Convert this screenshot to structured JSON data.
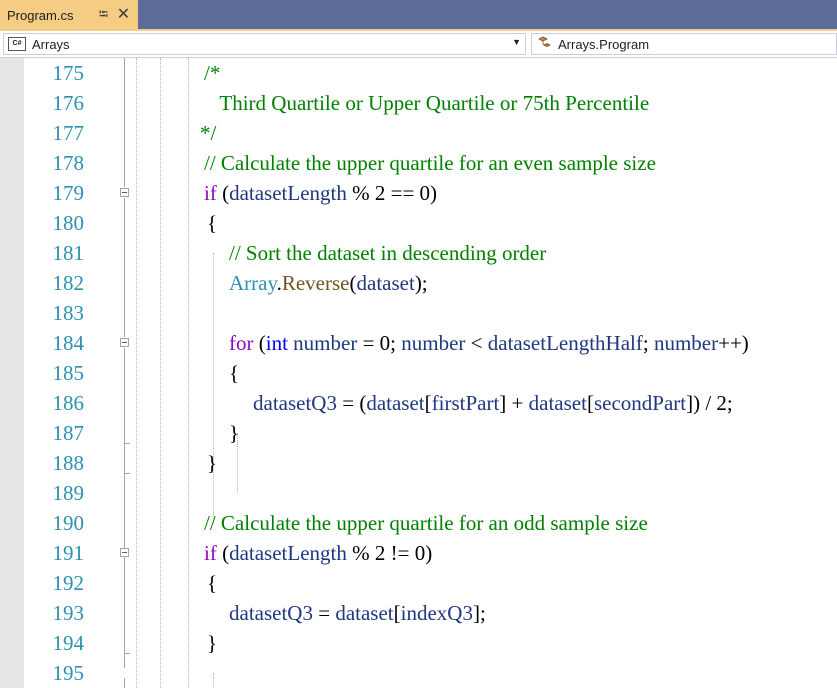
{
  "tab": {
    "title": "Program.cs",
    "pin_glyph": "⭾",
    "close_glyph": "✕"
  },
  "navbar": {
    "project_badge": "C#",
    "project": "Arrays",
    "member": "Arrays.Program"
  },
  "icons": {
    "project": "csharp-file-icon",
    "member": "class-member-icon",
    "collapse": "collapse-minus-icon"
  },
  "colors": {
    "tab_active": "#f5cc84",
    "tab_strip": "#5d6b99",
    "line_number": "#2b91af",
    "keyword": "#0000ff",
    "control_keyword": "#8f08c4",
    "comment": "#008000",
    "variable": "#1f377f",
    "method": "#74531f",
    "type": "#2b91af"
  },
  "code": {
    "lines": [
      {
        "number": "175",
        "tokens": [
          {
            "t": "/*",
            "c": "cmt"
          }
        ]
      },
      {
        "number": "176",
        "tokens": [
          {
            "t": "   Third Quartile or Upper Quartile or 75th Percentile",
            "c": "cmt"
          }
        ]
      },
      {
        "number": "177",
        "tokens": [
          {
            "t": "*/",
            "c": "cmt"
          }
        ]
      },
      {
        "number": "178",
        "tokens": [
          {
            "t": "// Calculate the upper quartile for an even sample size",
            "c": "cmt"
          }
        ]
      },
      {
        "number": "179",
        "tokens": [
          {
            "t": "if",
            "c": "ctl"
          },
          {
            "t": " (",
            "c": "op"
          },
          {
            "t": "datasetLength",
            "c": "var"
          },
          {
            "t": " % 2 == 0)",
            "c": "op"
          }
        ]
      },
      {
        "number": "180",
        "tokens": [
          {
            "t": "{",
            "c": "op"
          }
        ]
      },
      {
        "number": "181",
        "tokens": [
          {
            "t": "// Sort the dataset in descending order",
            "c": "cmt"
          }
        ]
      },
      {
        "number": "182",
        "tokens": [
          {
            "t": "Array",
            "c": "typ"
          },
          {
            "t": ".",
            "c": "op"
          },
          {
            "t": "Reverse",
            "c": "mth"
          },
          {
            "t": "(",
            "c": "op"
          },
          {
            "t": "dataset",
            "c": "var"
          },
          {
            "t": ");",
            "c": "op"
          }
        ]
      },
      {
        "number": "183",
        "tokens": []
      },
      {
        "number": "184",
        "tokens": [
          {
            "t": "for",
            "c": "ctl"
          },
          {
            "t": " (",
            "c": "op"
          },
          {
            "t": "int",
            "c": "kw"
          },
          {
            "t": " ",
            "c": "op"
          },
          {
            "t": "number",
            "c": "var"
          },
          {
            "t": " = 0; ",
            "c": "op"
          },
          {
            "t": "number",
            "c": "var"
          },
          {
            "t": " < ",
            "c": "op"
          },
          {
            "t": "datasetLengthHalf",
            "c": "var"
          },
          {
            "t": "; ",
            "c": "op"
          },
          {
            "t": "number",
            "c": "var"
          },
          {
            "t": "++)",
            "c": "op"
          }
        ]
      },
      {
        "number": "185",
        "tokens": [
          {
            "t": "{",
            "c": "op"
          }
        ]
      },
      {
        "number": "186",
        "tokens": [
          {
            "t": "datasetQ3",
            "c": "var"
          },
          {
            "t": " = (",
            "c": "op"
          },
          {
            "t": "dataset",
            "c": "var"
          },
          {
            "t": "[",
            "c": "op"
          },
          {
            "t": "firstPart",
            "c": "var"
          },
          {
            "t": "] + ",
            "c": "op"
          },
          {
            "t": "dataset",
            "c": "var"
          },
          {
            "t": "[",
            "c": "op"
          },
          {
            "t": "secondPart",
            "c": "var"
          },
          {
            "t": "]) / 2;",
            "c": "op"
          }
        ]
      },
      {
        "number": "187",
        "tokens": [
          {
            "t": "}",
            "c": "op"
          }
        ]
      },
      {
        "number": "188",
        "tokens": [
          {
            "t": "}",
            "c": "op"
          }
        ]
      },
      {
        "number": "189",
        "tokens": []
      },
      {
        "number": "190",
        "tokens": [
          {
            "t": "// Calculate the upper quartile for an odd sample size",
            "c": "cmt"
          }
        ]
      },
      {
        "number": "191",
        "tokens": [
          {
            "t": "if",
            "c": "ctl"
          },
          {
            "t": " (",
            "c": "op"
          },
          {
            "t": "datasetLength",
            "c": "var"
          },
          {
            "t": " % 2 != 0)",
            "c": "op"
          }
        ]
      },
      {
        "number": "192",
        "tokens": [
          {
            "t": "{",
            "c": "op"
          }
        ]
      },
      {
        "number": "193",
        "tokens": [
          {
            "t": "datasetQ3",
            "c": "var"
          },
          {
            "t": " = ",
            "c": "op"
          },
          {
            "t": "dataset",
            "c": "var"
          },
          {
            "t": "[",
            "c": "op"
          },
          {
            "t": "indexQ3",
            "c": "var"
          },
          {
            "t": "];",
            "c": "op"
          }
        ]
      },
      {
        "number": "194",
        "tokens": [
          {
            "t": "}",
            "c": "op"
          }
        ]
      },
      {
        "number": "195",
        "tokens": []
      }
    ]
  }
}
